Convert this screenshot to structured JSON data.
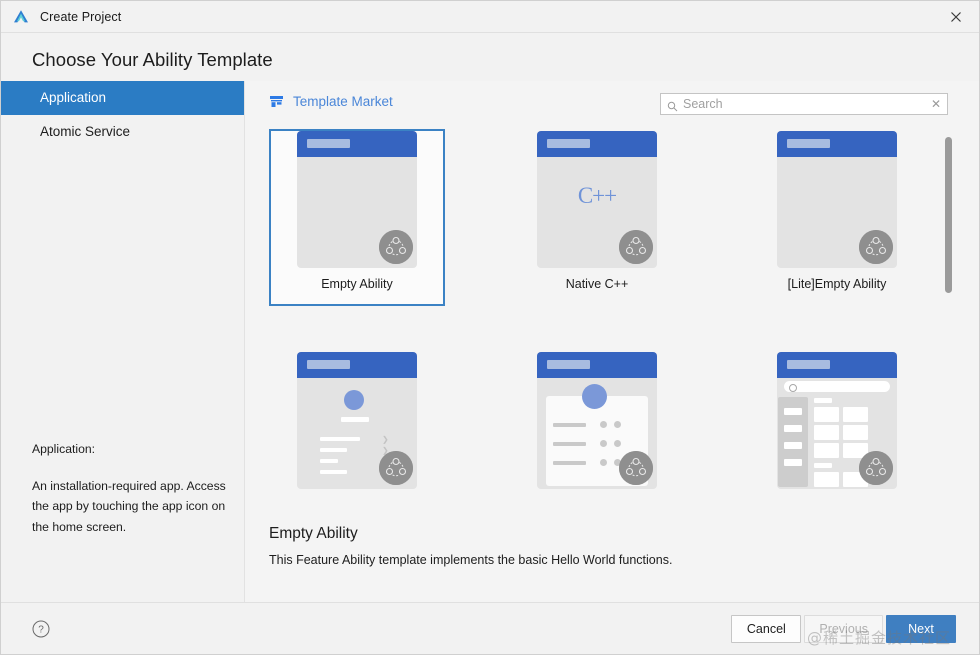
{
  "window": {
    "title": "Create Project",
    "logo_icon": "deveco-logo-icon",
    "close_icon": "close-icon"
  },
  "heading": "Choose Your Ability Template",
  "sidebar": {
    "items": [
      {
        "label": "Application",
        "selected": true
      },
      {
        "label": "Atomic Service",
        "selected": false
      }
    ],
    "description_title": "Application:",
    "description_body": "An installation-required app. Access the app by touching the app icon on the home screen."
  },
  "toolbar": {
    "market_label": "Template Market",
    "market_icon": "store-icon",
    "search_icon": "search-icon",
    "search_placeholder": "Search",
    "search_value": "",
    "search_clear_label": "✕"
  },
  "templates": [
    {
      "label": "Empty Ability",
      "variant": "empty",
      "selected": true
    },
    {
      "label": "Native C++",
      "variant": "cpp",
      "selected": false,
      "glyph": "C++"
    },
    {
      "label": "[Lite]Empty Ability",
      "variant": "empty",
      "selected": false
    },
    {
      "label": "",
      "variant": "profile",
      "selected": false
    },
    {
      "label": "",
      "variant": "cardlist",
      "selected": false
    },
    {
      "label": "",
      "variant": "catalog",
      "selected": false
    }
  ],
  "detail": {
    "title": "Empty Ability",
    "description": "This Feature Ability template implements the basic Hello World functions."
  },
  "footer": {
    "help_icon": "help-circle-icon",
    "cancel_label": "Cancel",
    "previous_label": "Previous",
    "next_label": "Next"
  },
  "watermark": "@稀土掘金技术社区",
  "colors": {
    "accent": "#2b7cc4",
    "primary_button": "#3f7fc1",
    "link": "#4a86d8",
    "thumb_header": "#3664c0",
    "selection_border": "#3b82c4"
  }
}
